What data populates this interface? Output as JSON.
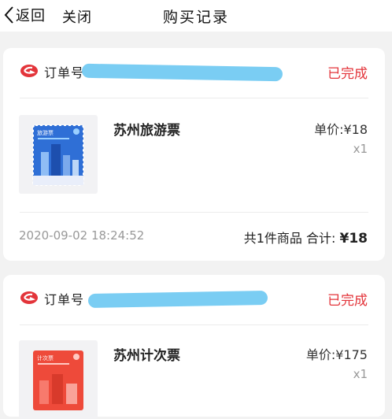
{
  "nav": {
    "back_label": "返回",
    "close_label": "关闭",
    "title": "购买记录"
  },
  "orders": [
    {
      "order_label": "订单号",
      "status": "已完成",
      "product_name": "苏州旅游票",
      "unit_price": "单价:¥18",
      "quantity": "x1",
      "ticket_caption": "旅游票",
      "date": "2020-09-02 18:24:52",
      "summary_prefix": "共1件商品 合计: ",
      "total": "¥18"
    },
    {
      "order_label": "订单号",
      "status": "已完成",
      "product_name": "苏州计次票",
      "unit_price": "单价:¥175",
      "quantity": "x1",
      "ticket_caption": "计次票"
    }
  ],
  "colors": {
    "status_red": "#e3343a",
    "brand_red": "#e3343a",
    "redaction_blue": "#6cc8f2",
    "ticket1_blue": "#2f6fd6",
    "ticket2_red": "#ee4a3a"
  },
  "icons": {
    "back": "chevron-left-icon",
    "brand": "brand-logo-icon"
  }
}
